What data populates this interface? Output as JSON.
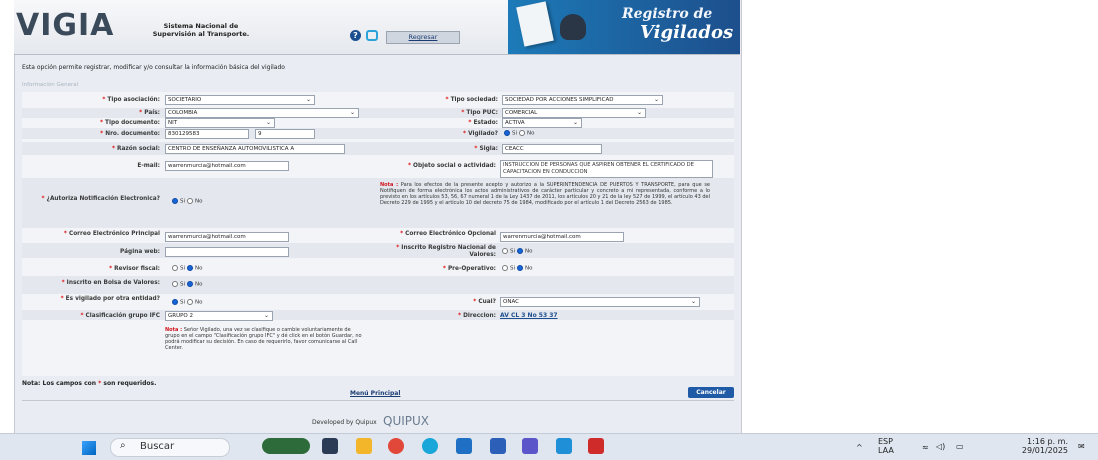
{
  "header": {
    "logo": "VIGIA",
    "system_title": "Sistema Nacional de Supervisión al Transporte.",
    "help": "?",
    "regresar": "Regresar",
    "banner_line1": "Registro de",
    "banner_line2": "Vigilados"
  },
  "intro": "Esta opción permite registrar, modificar y/o consultar la información básica del vigilado",
  "section_title": "Información General",
  "fields": {
    "tipo_asociacion": {
      "label": "Tipo asociación:",
      "value": "SOCIETARIO"
    },
    "tipo_sociedad": {
      "label": "Tipo sociedad:",
      "value": "SOCIEDAD POR ACCIONES SIMPLIFICAD"
    },
    "pais": {
      "label": "País:",
      "value": "COLOMBIA"
    },
    "tipo_puc": {
      "label": "Tipo PUC:",
      "value": "COMERCIAL"
    },
    "tipo_documento": {
      "label": "Tipo documento:",
      "value": "NIT"
    },
    "estado": {
      "label": "Estado:",
      "value": "ACTIVA"
    },
    "nro_documento": {
      "label": "Nro. documento:",
      "value": "830129583",
      "dv": "9"
    },
    "vigilado": {
      "label": "Vigilado?",
      "si": "Si",
      "no": "No"
    },
    "razon_social": {
      "label": "Razón social:",
      "value": "CENTRO DE ENSEÑANZA AUTOMOVILISTICA A"
    },
    "sigla": {
      "label": "Sigla:",
      "value": "CEACC"
    },
    "email": {
      "label": "E-mail:",
      "value": "warrenmurcia@hotmail.com"
    },
    "objeto_social": {
      "label": "Objeto social o actividad:",
      "value": "INSTRUCCION DE PERSONAS QUE ASPIREN OBTENER EL CERTIFICADO DE CAPACITACION EN CONDUCCION"
    },
    "autoriza": {
      "label": "¿Autoriza Notificación Electronica?",
      "si": "Si",
      "no": "No"
    },
    "correo_principal": {
      "label": "Correo Electrónico Principal",
      "value": "warrenmurcia@hotmail.com"
    },
    "correo_opcional": {
      "label": "Correo Electrónico Opcional",
      "value": "warrenmurcia@hotmail.com"
    },
    "pagina_web": {
      "label": "Página web:",
      "value": ""
    },
    "registro_valores": {
      "label": "Inscrito Registro Nacional de Valores:",
      "si": "Si",
      "no": "No"
    },
    "revisor_fiscal": {
      "label": "Revisor fiscal:",
      "si": "Si",
      "no": "No"
    },
    "pre_operativo": {
      "label": "Pre-Operativo:",
      "si": "Si",
      "no": "No"
    },
    "bolsa_valores": {
      "label": "Inscrito en Bolsa de Valores:",
      "si": "Si",
      "no": "No"
    },
    "vigilado_otra": {
      "label": "Es vigilado por otra entidad?",
      "si": "Si",
      "no": "No"
    },
    "cual": {
      "label": "Cual?",
      "value": "ONAC"
    },
    "clasificacion_ifc": {
      "label": "Clasificación grupo IFC",
      "value": "GRUPO 2"
    },
    "direccion": {
      "label": "Direccion:",
      "value": "AV CL 3 No 53 37"
    }
  },
  "nota_autoriza": {
    "prefix": "Nota :",
    "text": "Para los efectos de la presente acepto y autorizo a la SUPERINTENDENCIA DE PUERTOS Y TRANSPORTE, para que se Notifiquen de forma electrónica los actos administrativos de carácter particular y concreto a mi representada, conforme a lo previsto en los artículos 53, 56, 67 numeral 1 de la Ley 1437 de 2011, los artículos 20 y 21 de la ley 527 de 1999, el artículo 43 del Decreto 229 de 1995 y el artículo 10 del decreto 75 de 1984, modificado por el artículo 1 del Decreto 2563 de 1985."
  },
  "nota_ifc": {
    "prefix": "Nota :",
    "text": "Señor Vigilado, una vez se clasifique o cambie voluntariamente de grupo en el campo \"Clasificación grupo IFC\" y dé click en el botón Guardar, no podrá modificar su decisión. En caso de requerirlo, favor comunicarse al Call Center."
  },
  "footnote": {
    "prefix": "Nota: Los campos con",
    "mark": "*",
    "suffix": "son requeridos."
  },
  "menu_principal": "Menú Principal",
  "cancelar": "Cancelar",
  "developed_by": "Developed by Quipux",
  "quipux_logo": "QUIPUX",
  "taskbar": {
    "search": "Buscar",
    "lang1": "ESP",
    "lang2": "LAA",
    "time": "1:16 p. m.",
    "date": "29/01/2025"
  }
}
